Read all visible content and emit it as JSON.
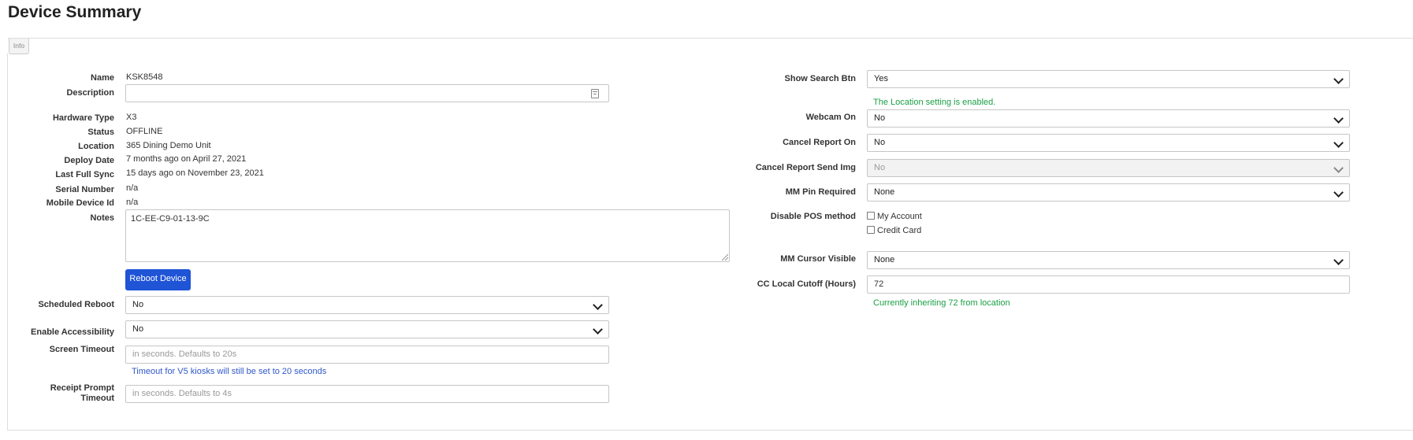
{
  "page": {
    "title": "Device Summary",
    "tab_info": "Info"
  },
  "left": {
    "name_label": "Name",
    "name_value": "KSK8548",
    "description_label": "Description",
    "description_value": "",
    "hardware_label": "Hardware Type",
    "hardware_value": "X3",
    "status_label": "Status",
    "status_value": "OFFLINE",
    "location_label": "Location",
    "location_value": "365 Dining Demo Unit",
    "deploy_label": "Deploy Date",
    "deploy_value": "7 months ago on April 27, 2021",
    "sync_label": "Last Full Sync",
    "sync_value": "15 days ago on November 23, 2021",
    "serial_label": "Serial Number",
    "serial_value": "n/a",
    "mobile_label": "Mobile Device Id",
    "mobile_value": "n/a",
    "notes_label": "Notes",
    "notes_value": "1C-EE-C9-01-13-9C",
    "reboot_button": "Reboot Device",
    "scheduled_reboot_label": "Scheduled Reboot",
    "scheduled_reboot_value": "No",
    "accessibility_label": "Enable Accessibility",
    "accessibility_value": "No",
    "screen_timeout_label": "Screen Timeout",
    "screen_timeout_placeholder": "in seconds. Defaults to 20s",
    "screen_timeout_hint": "Timeout for V5 kiosks will still be set to 20 seconds",
    "receipt_label_1": "Receipt Prompt",
    "receipt_label_2": "Timeout",
    "receipt_placeholder": "in seconds. Defaults to 4s"
  },
  "right": {
    "search_btn_label": "Show Search Btn",
    "search_btn_value": "Yes",
    "location_hint": "The Location setting is enabled.",
    "webcam_label": "Webcam On",
    "webcam_value": "No",
    "cancel_report_label": "Cancel Report On",
    "cancel_report_value": "No",
    "cancel_img_label": "Cancel Report Send Img",
    "cancel_img_value": "No",
    "mm_pin_label": "MM Pin Required",
    "mm_pin_value": "None",
    "disable_pos_label": "Disable POS method",
    "pos_option_1": "My Account",
    "pos_option_2": "Credit Card",
    "mm_cursor_label": "MM Cursor Visible",
    "mm_cursor_value": "None",
    "cc_cutoff_label": "CC Local Cutoff (Hours)",
    "cc_cutoff_value": "72",
    "cc_cutoff_hint": "Currently inheriting 72 from location"
  },
  "colors": {
    "button": "#1f54d6",
    "hint_green": "#1a9f44",
    "hint_blue": "#2f58c9"
  }
}
